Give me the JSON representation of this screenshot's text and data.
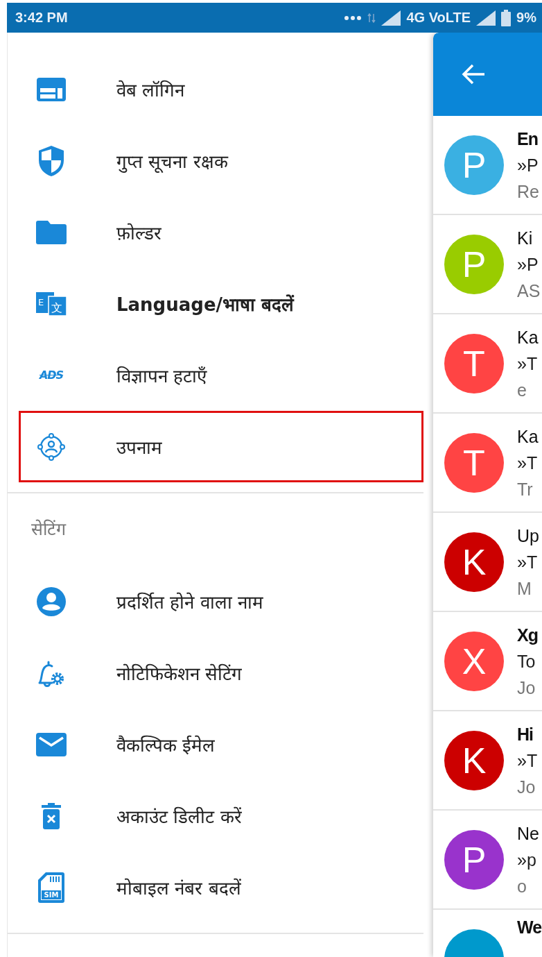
{
  "status_bar": {
    "time": "3:42 PM",
    "network": "4G VoLTE",
    "battery": "9%"
  },
  "drawer": {
    "sections": [
      {
        "items": [
          {
            "kind": "web-login",
            "label": "वेब लॉगिन",
            "bold": false,
            "selected": false
          },
          {
            "kind": "shield",
            "label": "गुप्त सूचना रक्षक",
            "bold": false,
            "selected": false
          },
          {
            "kind": "folder",
            "label": "फ़ोल्डर",
            "bold": false,
            "selected": false
          },
          {
            "kind": "translate",
            "label": "Language/भाषा बदलें",
            "bold": true,
            "selected": false,
            "icon_text": [
              "E",
              "文"
            ]
          },
          {
            "kind": "ads",
            "label": "विज्ञापन हटाएँ",
            "bold": false,
            "selected": false,
            "icon_text": [
              "ADS"
            ]
          },
          {
            "kind": "alias",
            "label": "उपनाम",
            "bold": false,
            "selected": true
          }
        ]
      },
      {
        "title": "सेटिंग",
        "items": [
          {
            "kind": "person",
            "label": "प्रदर्शित होने वाला नाम",
            "bold": false,
            "selected": false
          },
          {
            "kind": "bell-gear",
            "label": "नोटिफिकेशन सेटिंग",
            "bold": false,
            "selected": false
          },
          {
            "kind": "mail",
            "label": "वैकल्पिक ईमेल",
            "bold": false,
            "selected": false
          },
          {
            "kind": "delete",
            "label": "अकाउंट डिलीट करें",
            "bold": false,
            "selected": false
          },
          {
            "kind": "sim",
            "label": "मोबाइल नंबर बदलें",
            "bold": false,
            "selected": false,
            "icon_text": [
              "SIM"
            ]
          }
        ]
      }
    ]
  },
  "mail_panel": {
    "messages": [
      {
        "initial": "P",
        "color": "#3ab0e2",
        "unread": true,
        "sender": "En",
        "preview": "»P",
        "line_3": "Re"
      },
      {
        "initial": "P",
        "color": "#99cc00",
        "unread": false,
        "sender": "Ki",
        "preview": "»P",
        "line_3": "AS"
      },
      {
        "initial": "T",
        "color": "#ff4444",
        "unread": false,
        "sender": "Ka",
        "preview": "»T",
        "line_3": "e"
      },
      {
        "initial": "T",
        "color": "#ff4444",
        "unread": false,
        "sender": "Ka",
        "preview": "»T",
        "line_3": "Tr"
      },
      {
        "initial": "K",
        "color": "#cc0000",
        "unread": false,
        "sender": "Up",
        "preview": "»T",
        "line_3": "M"
      },
      {
        "initial": "X",
        "color": "#ff4444",
        "unread": true,
        "sender": "Xg",
        "preview": "To",
        "line_3": "Jo"
      },
      {
        "initial": "K",
        "color": "#cc0000",
        "unread": true,
        "sender": "Hi",
        "preview": "»T",
        "line_3": "Jo"
      },
      {
        "initial": "P",
        "color": "#9933cc",
        "unread": false,
        "sender": "Ne",
        "preview": "»p",
        "line_3": "o"
      },
      {
        "color": "#0099cc",
        "unread": true,
        "sender": "We"
      }
    ]
  }
}
